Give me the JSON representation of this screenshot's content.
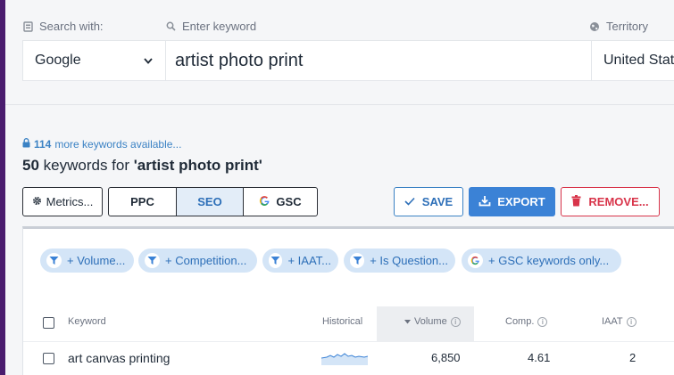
{
  "search": {
    "engine_label": "Search with:",
    "keyword_label": "Enter keyword",
    "territory_label": "Territory",
    "engine_value": "Google",
    "keyword_value": "artist photo print",
    "territory_value": "United States"
  },
  "results": {
    "more_count": "114",
    "more_text": "more keywords available...",
    "count": "50",
    "keywords_for": "keywords for",
    "query_quoted": "'artist photo print'"
  },
  "toolbar": {
    "metrics_label": "Metrics...",
    "ppc_label": "PPC",
    "seo_label": "SEO",
    "gsc_label": "GSC",
    "save_label": "SAVE",
    "export_label": "EXPORT",
    "remove_label": "REMOVE..."
  },
  "filters": [
    "+ Volume...",
    "+ Competition...",
    "+ IAAT...",
    "+ Is Question...",
    "+ GSC keywords only..."
  ],
  "table": {
    "columns": {
      "keyword": "Keyword",
      "historical": "Historical",
      "volume": "Volume",
      "comp": "Comp.",
      "iaat": "IAAT"
    },
    "rows": [
      {
        "keyword": "art canvas printing",
        "volume": "6,850",
        "comp": "4.61",
        "iaat": "2"
      }
    ]
  },
  "colors": {
    "accent": "#3b82d6",
    "danger": "#d8344a",
    "chip_bg": "#d4e5f7",
    "sidebar": "#4a1c6e"
  }
}
